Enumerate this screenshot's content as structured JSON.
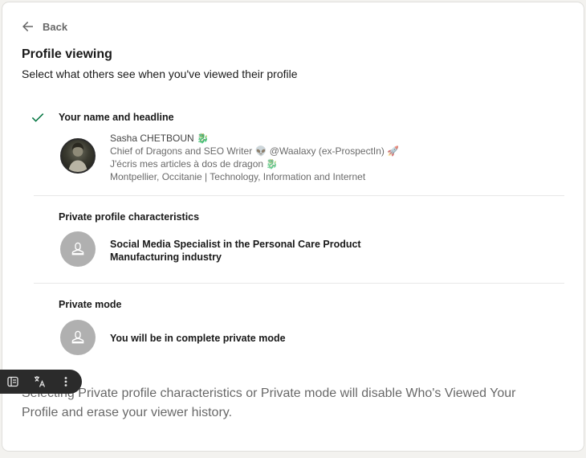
{
  "nav": {
    "back_label": "Back"
  },
  "header": {
    "title": "Profile viewing",
    "subtitle": "Select what others see when you've viewed their profile"
  },
  "options": [
    {
      "label": "Your name and headline",
      "selected": true,
      "profile": {
        "name": "Sasha CHETBOUN 🐉",
        "headline": "Chief of Dragons and SEO Writer 👽 @Waalaxy (ex-ProspectIn) 🚀",
        "tagline": "J'écris mes articles à dos de dragon 🐉",
        "location": "Montpellier, Occitanie | Technology, Information and Internet"
      }
    },
    {
      "label": "Private profile characteristics",
      "selected": false,
      "description": "Social Media Specialist in the Personal Care Product Manufacturing industry"
    },
    {
      "label": "Private mode",
      "selected": false,
      "description": "You will be in complete private mode"
    }
  ],
  "footnote": "Selecting Private profile characteristics or Private mode will disable Who's Viewed Your Profile and erase your viewer history.",
  "icons": {
    "back": "arrow-left-icon",
    "check": "checkmark-icon",
    "ghost": "ghost-person-icon",
    "toolbar": [
      "reader-icon",
      "translate-icon",
      "more-vertical-icon"
    ]
  },
  "colors": {
    "accent_check": "#057642",
    "card_bg": "#ffffff",
    "page_bg": "#f3f2ef",
    "toolbar_bg": "#2b2b2b"
  }
}
